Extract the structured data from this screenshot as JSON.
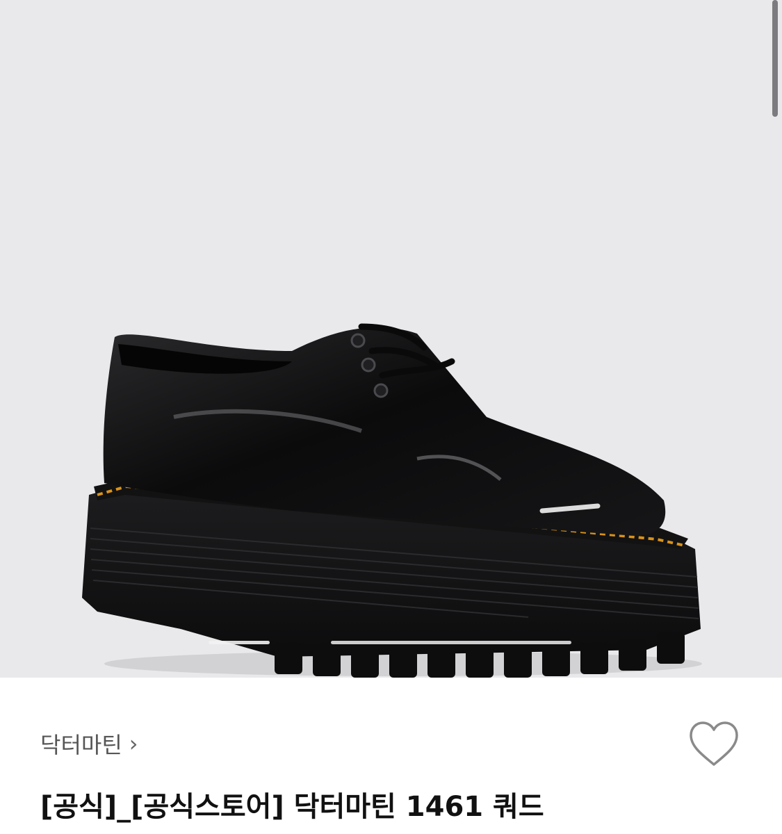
{
  "hero_image": {
    "background_color": "#e9e9eb",
    "subject": "black patent leather platform derby shoe"
  },
  "brand": {
    "name": "닥터마틴",
    "chevron": "›"
  },
  "product": {
    "title": "[공식]_[공식스토어] 닥터마틴 1461 쿼드"
  },
  "icons": {
    "wishlist": "heart-outline-icon"
  },
  "colors": {
    "title_text": "#111111",
    "brand_text": "#555555",
    "stitch": "#d9921a"
  }
}
